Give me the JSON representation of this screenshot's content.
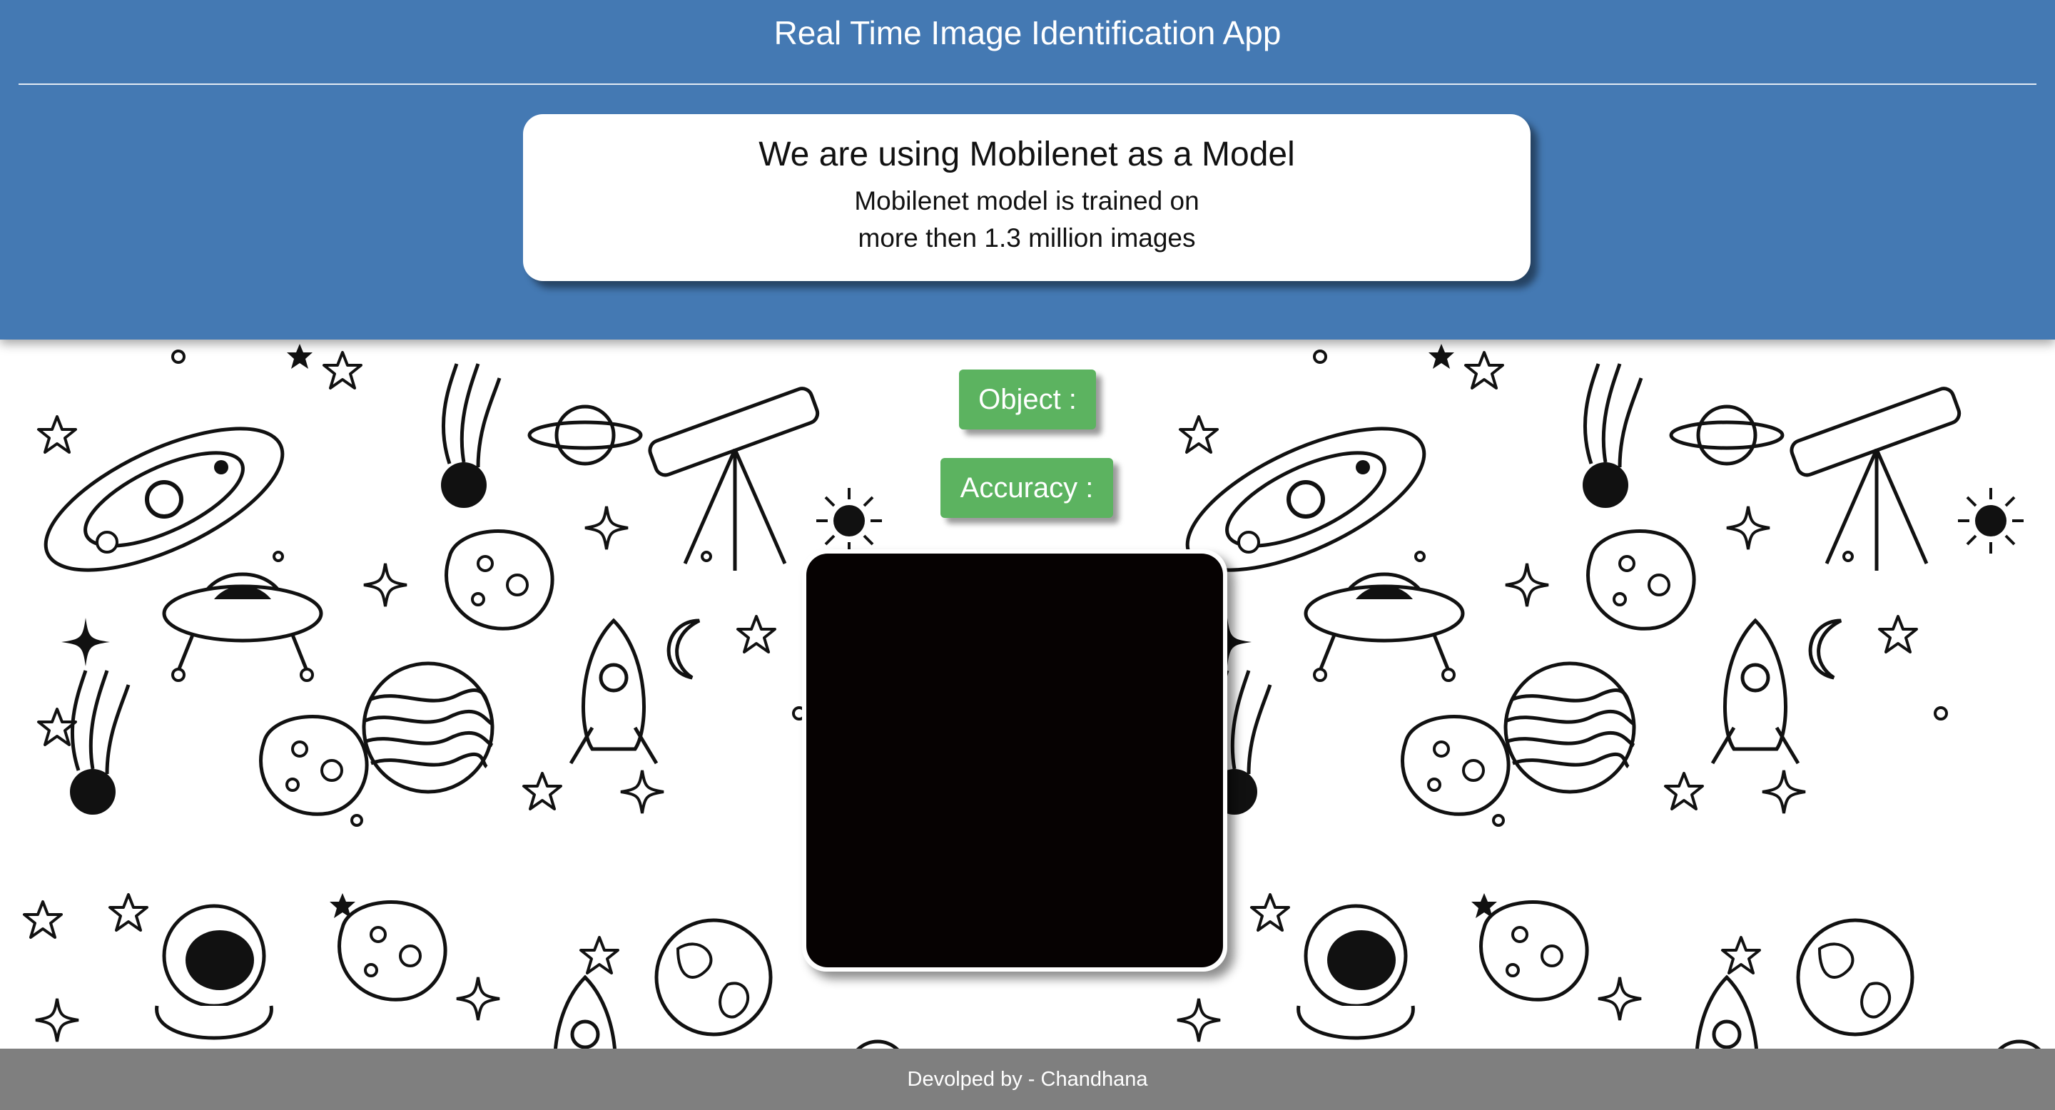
{
  "header": {
    "title": "Real Time Image Identification App"
  },
  "model_card": {
    "heading": "We are using Mobilenet as a Model",
    "line1": "Mobilenet model is trained on",
    "line2": "more then 1.3 million images"
  },
  "results": {
    "object_label": "Object :",
    "accuracy_label": "Accuracy :"
  },
  "footer": {
    "credit": "Devolped by - Chandhana"
  },
  "colors": {
    "header_bg": "#4479b3",
    "badge_bg": "#5cb360",
    "footer_bg": "#7f7f7f",
    "video_bg": "#060202"
  },
  "background": {
    "pattern": "space-doodle",
    "icons": [
      "planet-icon",
      "star-icon",
      "ufo-icon",
      "rocket-icon",
      "telescope-icon",
      "astronaut-icon",
      "comet-icon",
      "asteroid-icon",
      "moon-icon",
      "earth-icon",
      "satellite-icon",
      "sun-icon"
    ]
  }
}
